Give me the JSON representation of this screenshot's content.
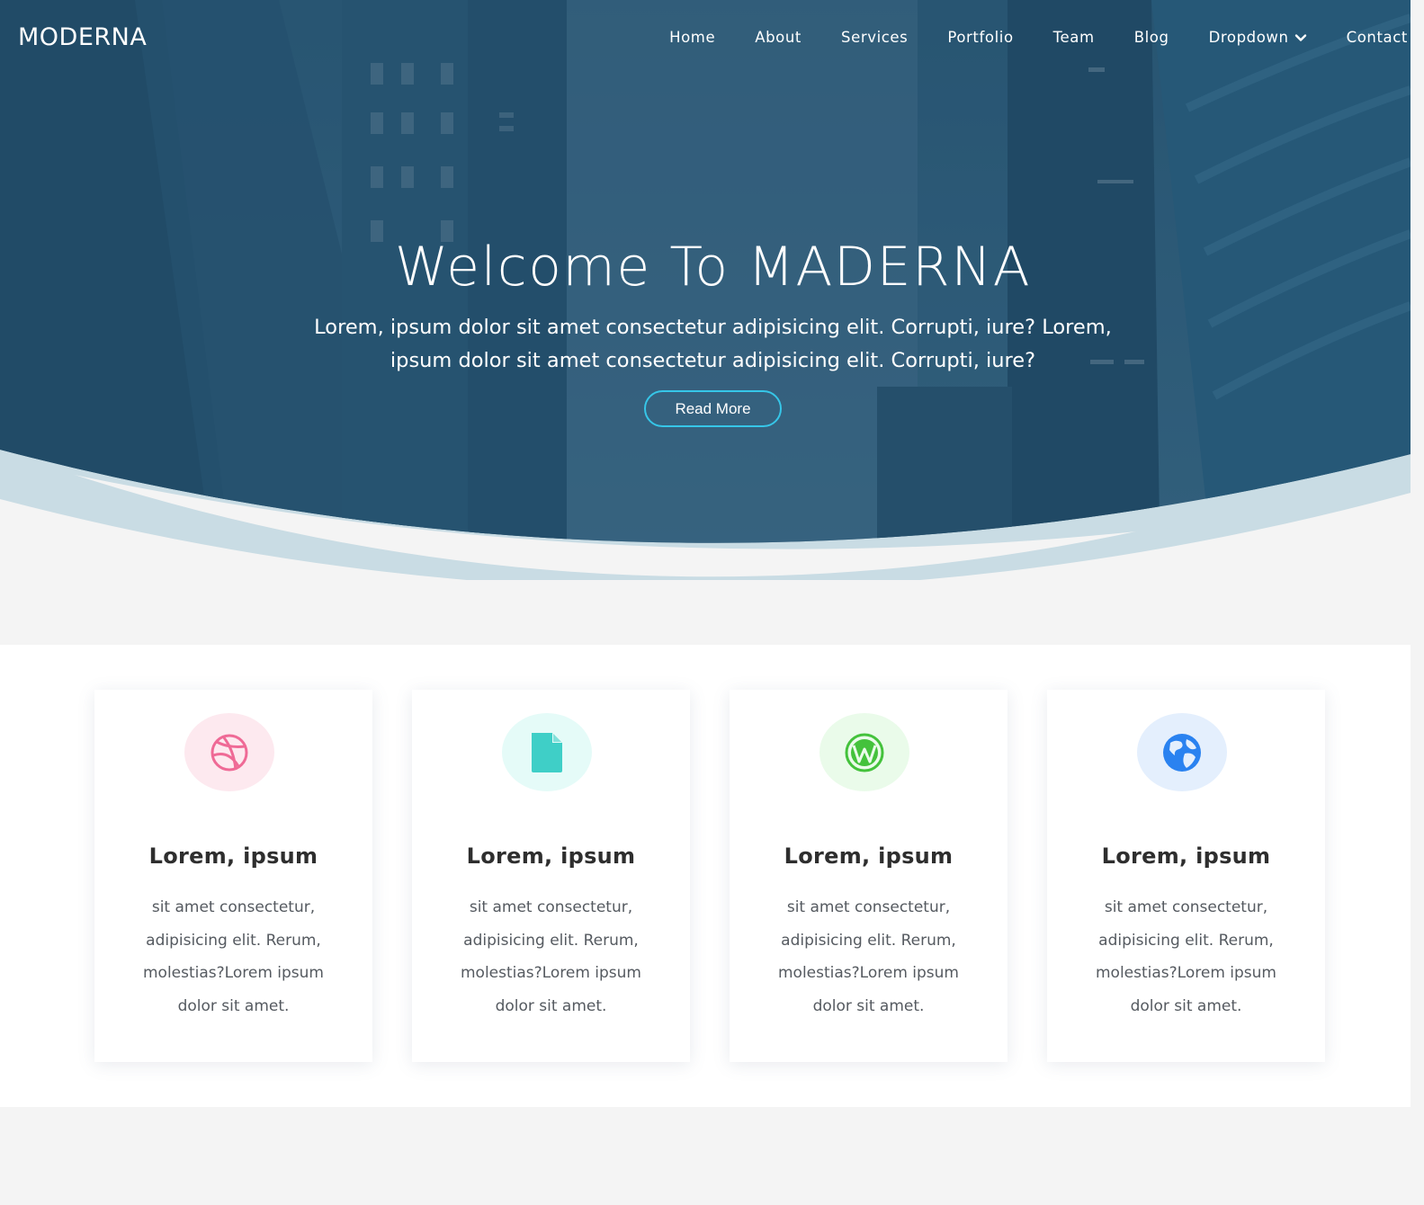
{
  "brand": {
    "logo": "MODERNA"
  },
  "nav": {
    "items": [
      "Home",
      "About",
      "Services",
      "Portfolio",
      "Team",
      "Blog",
      "Dropdown",
      "Contact"
    ]
  },
  "hero": {
    "title": "Welcome To MADERNA",
    "subtitle": "Lorem, ipsum dolor sit amet consectetur adipisicing elit. Corrupti, iure? Lorem, ipsum dolor sit amet consectetur adipisicing elit. Corrupti, iure?",
    "button": "Read More"
  },
  "features": [
    {
      "icon": "dribbble-icon",
      "color": "#ef6a96",
      "bg": "#fde9ef",
      "title": "Lorem, ipsum",
      "text": "sit amet consectetur, adipisicing elit. Rerum, molestias?Lorem ipsum dolor sit amet."
    },
    {
      "icon": "file-icon",
      "color": "#3fcfc7",
      "bg": "#e5fbf8",
      "title": "Lorem, ipsum",
      "text": "sit amet consectetur, adipisicing elit. Rerum, molestias?Lorem ipsum dolor sit amet."
    },
    {
      "icon": "wordpress-icon",
      "color": "#44c23c",
      "bg": "#eafbea",
      "title": "Lorem, ipsum",
      "text": "sit amet consectetur, adipisicing elit. Rerum, molestias?Lorem ipsum dolor sit amet."
    },
    {
      "icon": "globe-icon",
      "color": "#2a82f0",
      "bg": "#e4effd",
      "title": "Lorem, ipsum",
      "text": "sit amet consectetur, adipisicing elit. Rerum, molestias?Lorem ipsum dolor sit amet."
    }
  ],
  "colors": {
    "hero_overlay": "#2b5875",
    "accent": "#36c6e8",
    "wave": "#c9dce4",
    "section_bg": "#f4f4f4"
  }
}
